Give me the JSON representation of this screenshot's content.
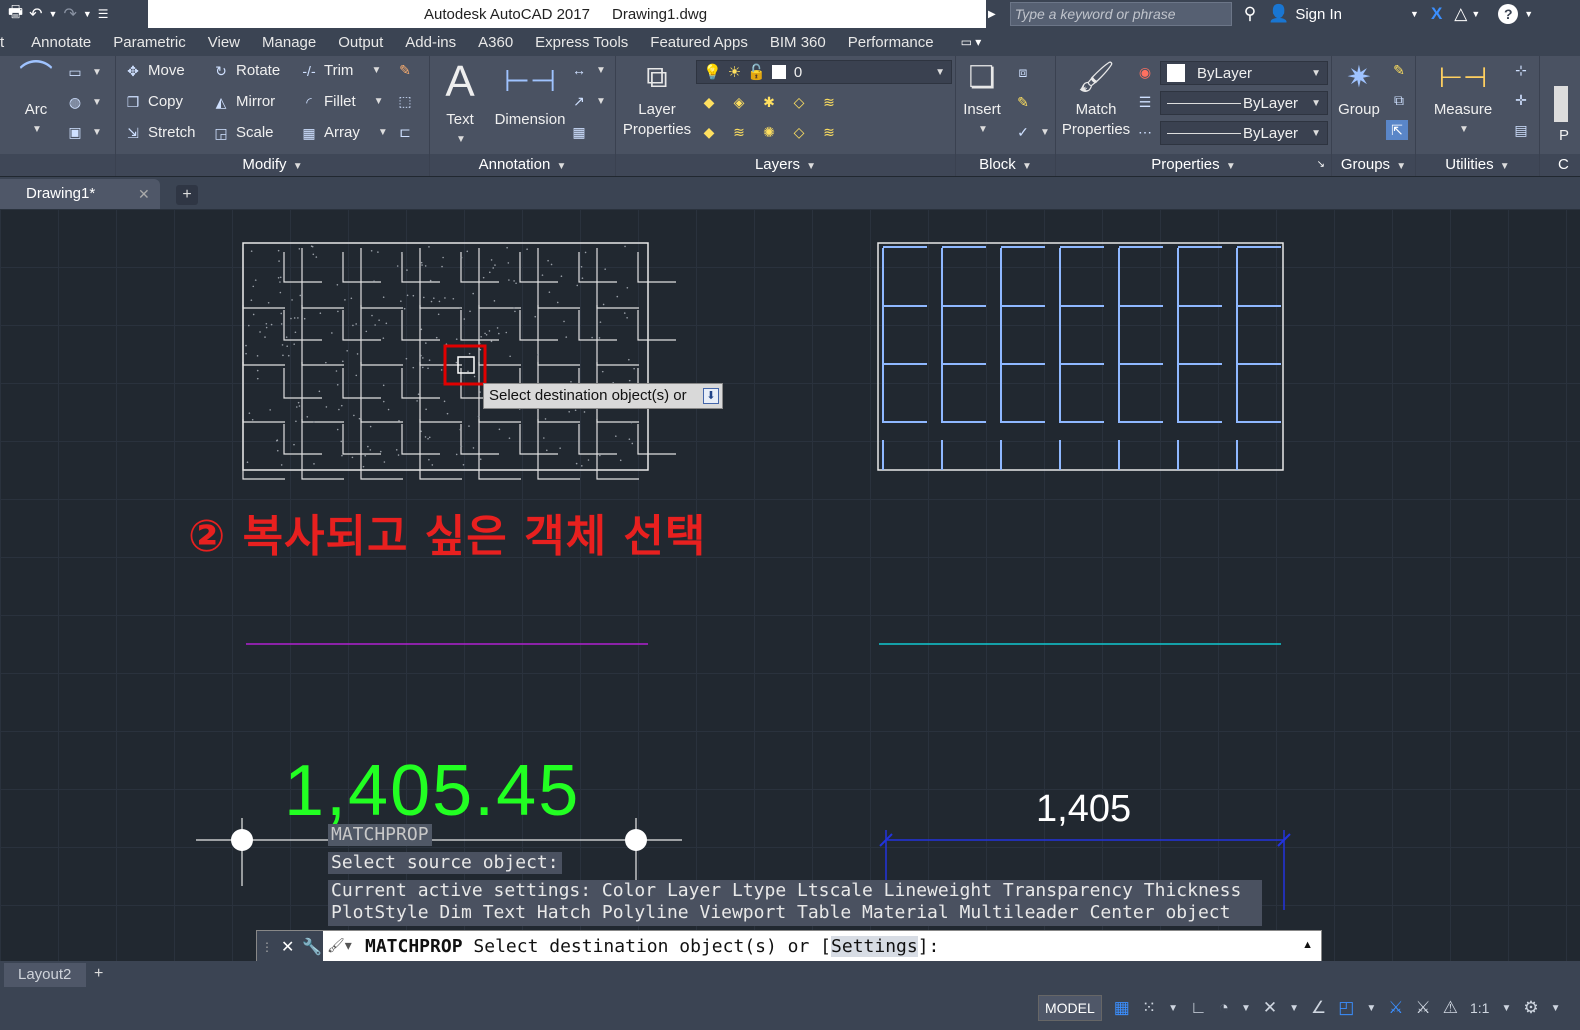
{
  "window": {
    "app_title": "Autodesk AutoCAD 2017",
    "file_name": "Drawing1.dwg",
    "search_placeholder": "Type a keyword or phrase",
    "sign_in": "Sign In"
  },
  "ribbon_tabs": [
    "t",
    "Annotate",
    "Parametric",
    "View",
    "Manage",
    "Output",
    "Add-ins",
    "A360",
    "Express Tools",
    "Featured Apps",
    "BIM 360",
    "Performance"
  ],
  "ribbon": {
    "draw": {
      "arc": "Arc"
    },
    "modify": {
      "title": "Modify",
      "move": "Move",
      "rotate": "Rotate",
      "trim": "Trim",
      "copy": "Copy",
      "mirror": "Mirror",
      "fillet": "Fillet",
      "stretch": "Stretch",
      "scale": "Scale",
      "array": "Array"
    },
    "annotation": {
      "title": "Annotation",
      "text": "Text",
      "dimension": "Dimension"
    },
    "layers": {
      "title": "Layers",
      "layer_properties_1": "Layer",
      "layer_properties_2": "Properties",
      "current_layer": "0"
    },
    "block": {
      "title": "Block",
      "insert": "Insert"
    },
    "properties": {
      "title": "Properties",
      "match_1": "Match",
      "match_2": "Properties",
      "color": "ByLayer",
      "linetype": "ByLayer",
      "lineweight": "ByLayer"
    },
    "groups": {
      "title": "Groups",
      "group": "Group"
    },
    "utilities": {
      "title": "Utilities",
      "measure": "Measure"
    },
    "clip": {
      "p": "P",
      "c": "C"
    }
  },
  "doc_tab": {
    "name": "Drawing1*"
  },
  "canvas": {
    "tooltip": "Select destination object(s) or",
    "annotation": "② 복사되고 싶은 객체 선택",
    "green_text": "1,405.45",
    "dimension_text": "1,405",
    "colors": {
      "magenta_line": "#b020d0",
      "cyan_line": "#10c8d0",
      "green_text": "#22ff22",
      "dim_blue": "#2233dd",
      "annotation_red": "#e8201f"
    }
  },
  "history": {
    "line1": "MATCHPROP",
    "line2": "Select source object:",
    "line3": "Current active settings:  Color Layer Ltype Ltscale Lineweight Transparency Thickness PlotStyle Dim Text Hatch Polyline Viewport Table Material Multileader Center object"
  },
  "command_line": {
    "command": "MATCHPROP",
    "prompt": "Select destination object(s) or [",
    "option": "Settings",
    "suffix": "]:"
  },
  "layout_tabs": {
    "layout2": "Layout2"
  },
  "status": {
    "model": "MODEL",
    "scale": "1:1"
  }
}
